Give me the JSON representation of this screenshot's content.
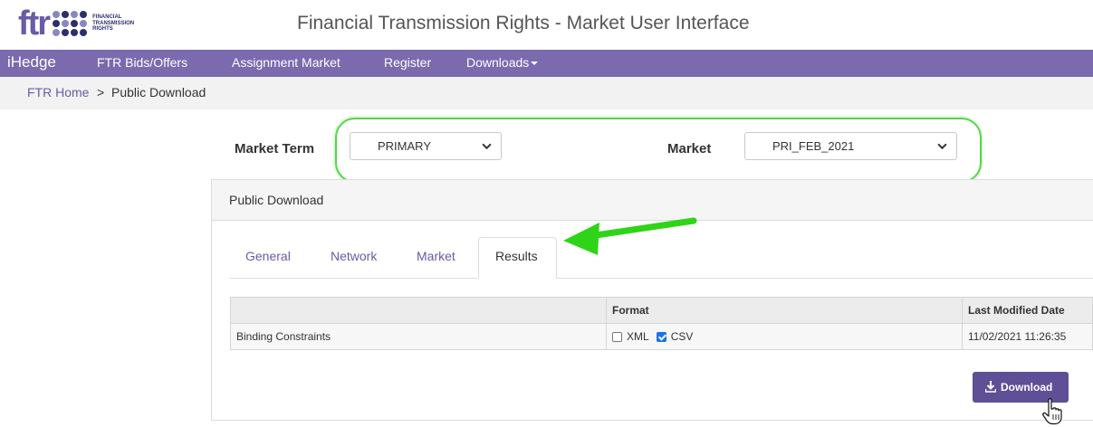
{
  "header": {
    "logo_text": "ftr",
    "logo_sub": [
      "FINANCIAL",
      "TRANSMISSION",
      "RIGHTS"
    ],
    "app_title": "Financial Transmission Rights - Market User Interface"
  },
  "nav": {
    "brand": "iHedge",
    "items": [
      "FTR Bids/Offers",
      "Assignment Market",
      "Register",
      "Downloads"
    ]
  },
  "breadcrumb": {
    "home": "FTR Home",
    "separator": ">",
    "current": "Public Download"
  },
  "filters": {
    "market_term_label": "Market Term",
    "market_term_value": "PRIMARY",
    "market_label": "Market",
    "market_value": "PRI_FEB_2021"
  },
  "panel": {
    "title": "Public Download",
    "tabs": [
      "General",
      "Network",
      "Market",
      "Results"
    ],
    "active_tab": "Results"
  },
  "table": {
    "headers": [
      "",
      "Format",
      "Last Modified Date"
    ],
    "rows": [
      {
        "name": "Binding Constraints",
        "xml_label": "XML",
        "xml_checked": false,
        "csv_label": "CSV",
        "csv_checked": true,
        "modified": "11/02/2021 11:26:35"
      }
    ]
  },
  "download_button": "Download",
  "colors": {
    "brand_purple": "#7b6aae",
    "button_purple": "#5e4f96",
    "highlight_green": "#58d64a"
  }
}
